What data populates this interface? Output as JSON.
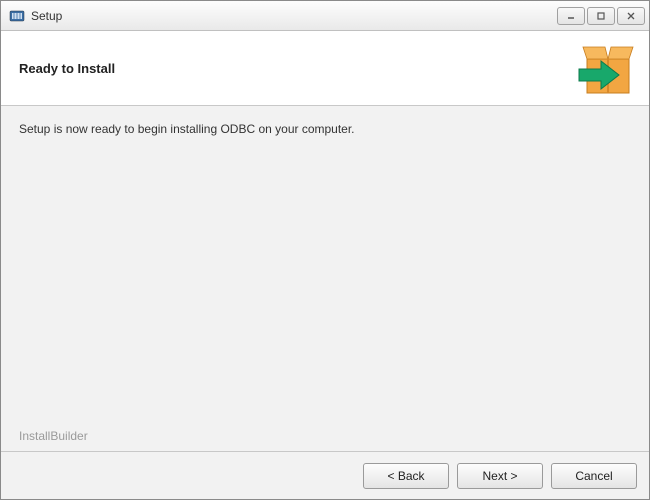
{
  "window": {
    "title": "Setup"
  },
  "header": {
    "title": "Ready to Install"
  },
  "content": {
    "message": "Setup is now ready to begin installing ODBC on your computer.",
    "branding": "InstallBuilder"
  },
  "buttons": {
    "back": "< Back",
    "next": "Next >",
    "cancel": "Cancel"
  }
}
